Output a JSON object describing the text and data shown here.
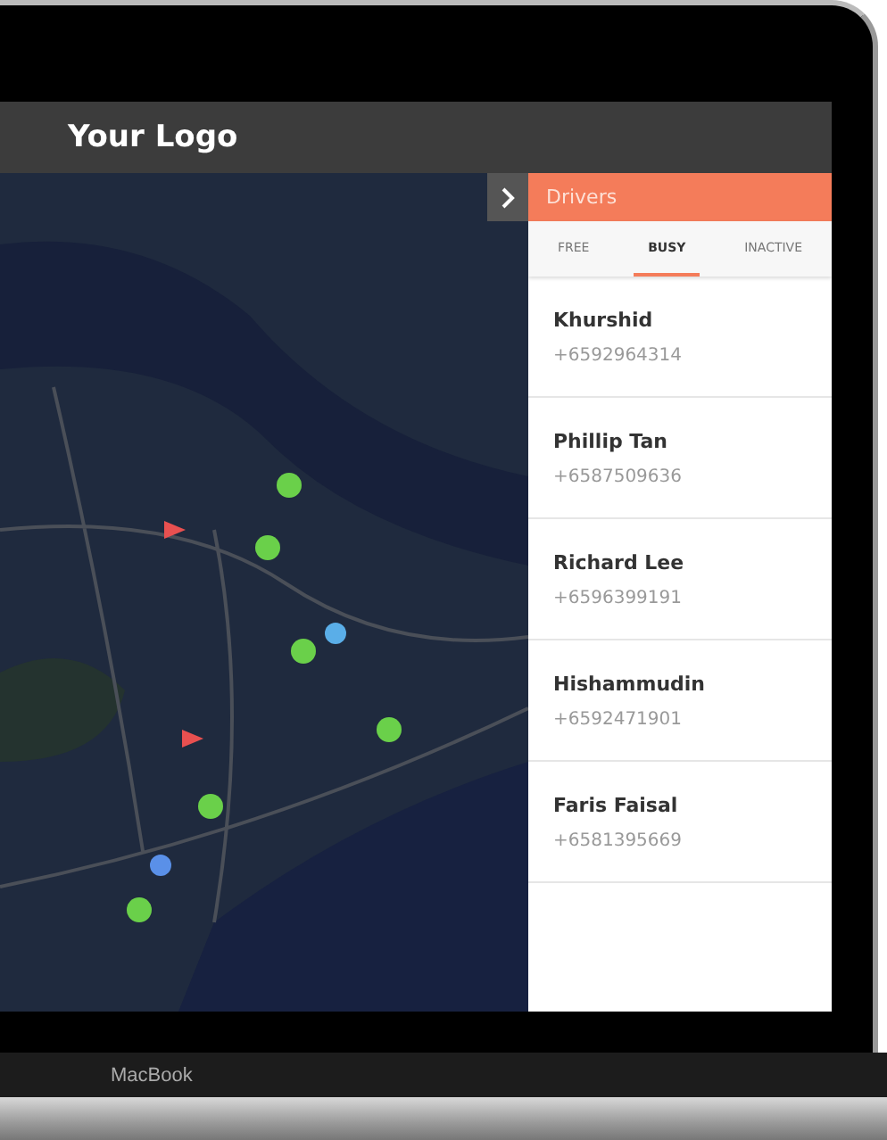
{
  "header": {
    "logo": "Your Logo"
  },
  "panel": {
    "title": "Drivers",
    "tabs": [
      {
        "label": "FREE",
        "selected": false
      },
      {
        "label": "BUSY",
        "selected": true
      },
      {
        "label": "INACTIVE",
        "selected": false
      }
    ],
    "drivers": [
      {
        "name": "Khurshid",
        "phone": "+6592964314"
      },
      {
        "name": "Phillip Tan",
        "phone": "+6587509636"
      },
      {
        "name": "Richard Lee",
        "phone": "+6596399191"
      },
      {
        "name": "Hishammudin",
        "phone": "+6592471901"
      },
      {
        "name": "Faris Faisal",
        "phone": "+6581395669"
      }
    ]
  },
  "laptop": {
    "label": "MacBook"
  }
}
